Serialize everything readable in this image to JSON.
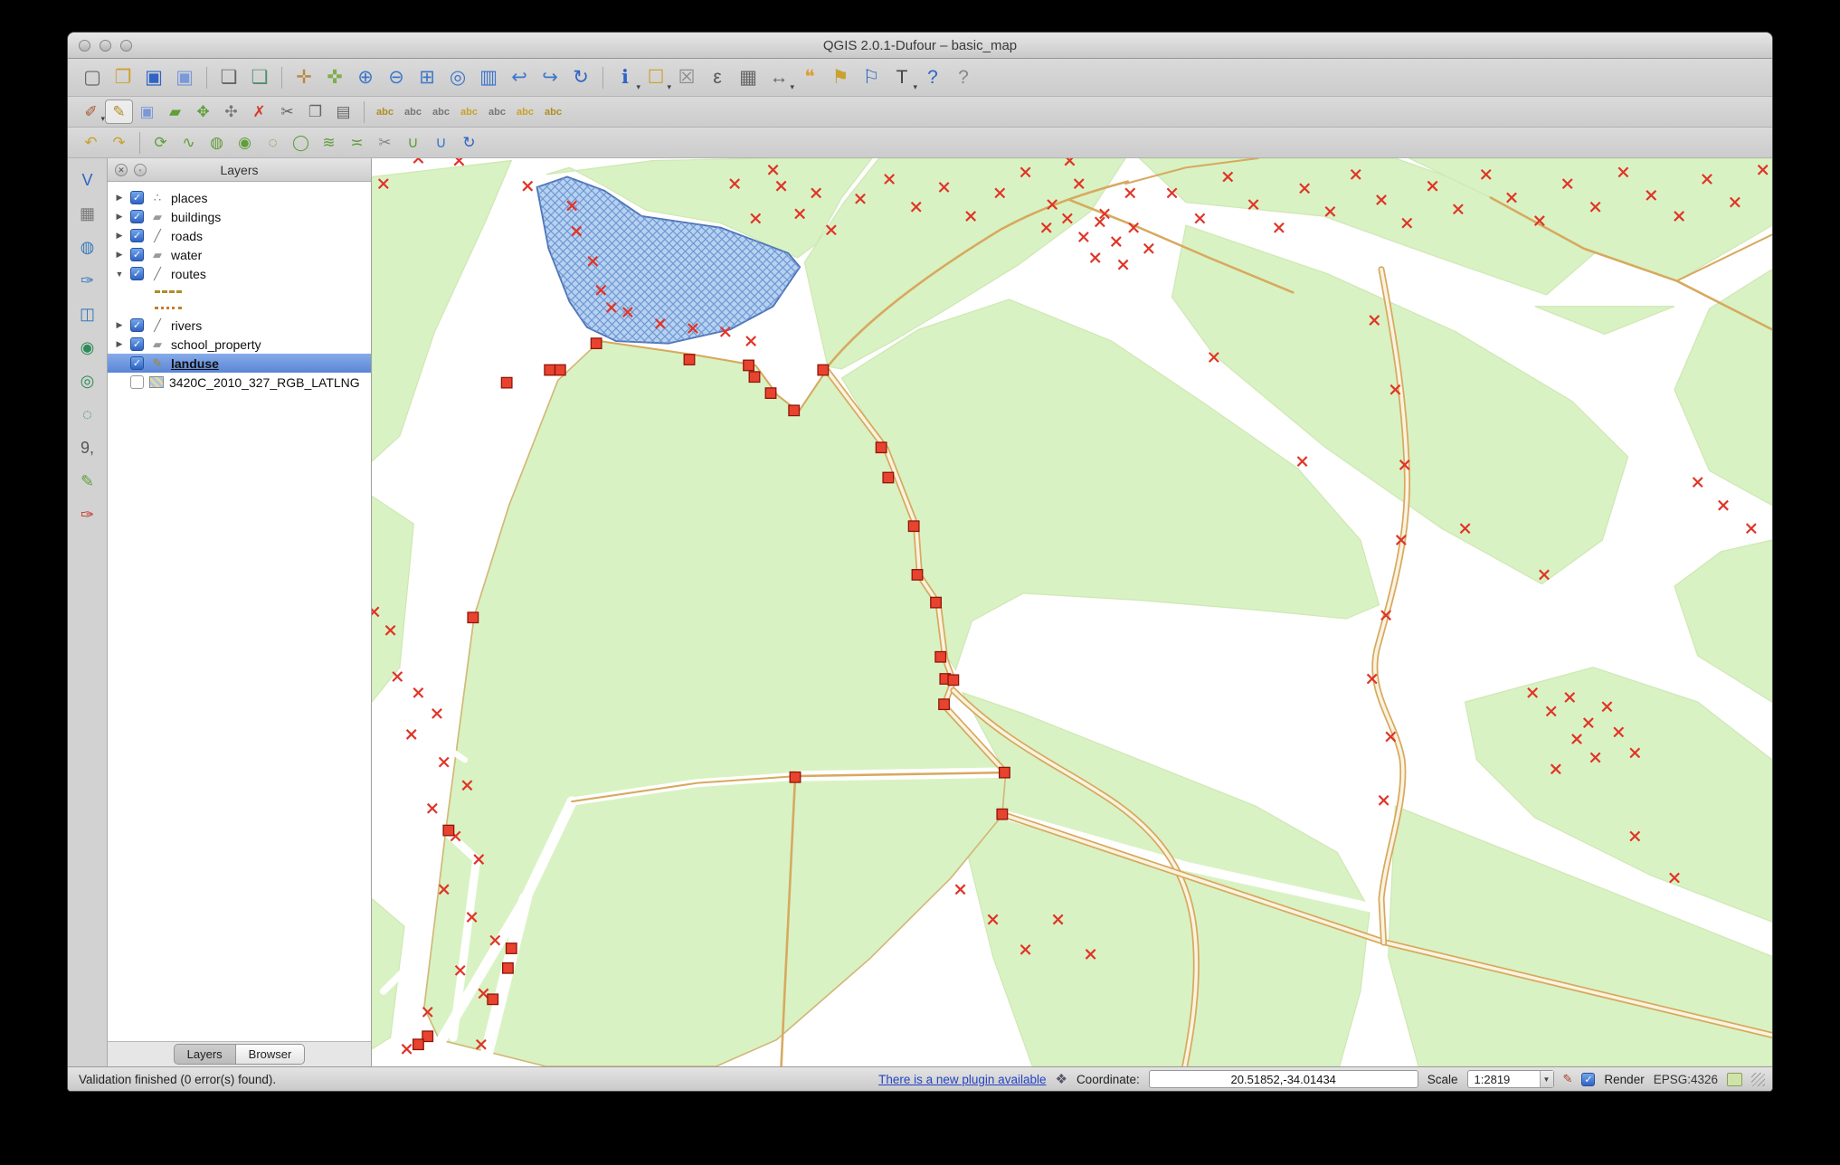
{
  "window": {
    "title": "QGIS 2.0.1-Dufour – basic_map"
  },
  "toolbars": {
    "row1": [
      {
        "name": "new-project",
        "glyph": "▢",
        "color": "#666"
      },
      {
        "name": "open-project",
        "glyph": "❐",
        "color": "#cfa02e"
      },
      {
        "name": "save-project",
        "glyph": "▣",
        "color": "#2f63c4"
      },
      {
        "name": "save-project-as",
        "glyph": "▣",
        "color": "#7b98d8"
      },
      {
        "sep": true
      },
      {
        "name": "new-print-composer",
        "glyph": "❏",
        "color": "#666"
      },
      {
        "name": "composer-manager",
        "glyph": "❏",
        "color": "#4f8f6f"
      },
      {
        "sep": true
      },
      {
        "name": "pan-map",
        "glyph": "✛",
        "color": "#b98a3f"
      },
      {
        "name": "pan-to-selection",
        "glyph": "✜",
        "color": "#7fae4f"
      },
      {
        "name": "zoom-in",
        "glyph": "⊕",
        "color": "#3e77c9"
      },
      {
        "name": "zoom-out",
        "glyph": "⊖",
        "color": "#3e77c9"
      },
      {
        "name": "zoom-full",
        "glyph": "⊞",
        "color": "#3e77c9"
      },
      {
        "name": "zoom-to-selection",
        "glyph": "◎",
        "color": "#3e77c9"
      },
      {
        "name": "zoom-to-layer",
        "glyph": "▥",
        "color": "#3e77c9"
      },
      {
        "name": "zoom-last",
        "glyph": "↩",
        "color": "#3e77c9"
      },
      {
        "name": "zoom-next",
        "glyph": "↪",
        "color": "#3e77c9"
      },
      {
        "name": "refresh-map",
        "glyph": "↻",
        "color": "#2f63c4"
      },
      {
        "sep": true
      },
      {
        "name": "identify-features",
        "glyph": "ℹ",
        "color": "#2f63c4",
        "dd": true
      },
      {
        "name": "select-features",
        "glyph": "☐",
        "color": "#caa12c",
        "dd": true
      },
      {
        "name": "deselect-features",
        "glyph": "☒",
        "color": "#8a8a8a"
      },
      {
        "name": "field-calculator",
        "glyph": "ε",
        "color": "#555"
      },
      {
        "name": "attribute-table",
        "glyph": "▦",
        "color": "#666"
      },
      {
        "name": "measure",
        "glyph": "↔",
        "color": "#666",
        "dd": true
      },
      {
        "name": "map-tips",
        "glyph": "❝",
        "color": "#dd9c2e"
      },
      {
        "name": "new-bookmark",
        "glyph": "⚑",
        "color": "#caa12c"
      },
      {
        "name": "show-bookmarks",
        "glyph": "⚐",
        "color": "#2f63c4"
      },
      {
        "name": "text-annotation",
        "glyph": "T",
        "color": "#444",
        "dd": true
      },
      {
        "name": "help-contents",
        "glyph": "?",
        "color": "#2f63c4"
      },
      {
        "name": "whats-this",
        "glyph": "?",
        "color": "#888"
      }
    ],
    "row2": [
      {
        "name": "current-edits",
        "glyph": "✐",
        "color": "#a5572c",
        "dd": true
      },
      {
        "name": "toggle-editing",
        "glyph": "✎",
        "color": "#b08c28",
        "pressed": true
      },
      {
        "name": "save-layer-edits",
        "glyph": "▣",
        "color": "#7b98d8"
      },
      {
        "name": "add-feature",
        "glyph": "▰",
        "color": "#5f9e3a"
      },
      {
        "name": "move-feature",
        "glyph": "✥",
        "color": "#5f9e3a"
      },
      {
        "name": "node-tool",
        "glyph": "✣",
        "color": "#777"
      },
      {
        "name": "delete-selected",
        "glyph": "✗",
        "color": "#d23b2e"
      },
      {
        "name": "cut-features",
        "glyph": "✂",
        "color": "#666"
      },
      {
        "name": "copy-features",
        "glyph": "❐",
        "color": "#666"
      },
      {
        "name": "paste-features",
        "glyph": "▤",
        "color": "#666"
      },
      {
        "sep": true
      },
      {
        "name": "layer-labeling-options",
        "glyph": "abc",
        "color": "#b08c28"
      },
      {
        "name": "move-label",
        "glyph": "abc",
        "color": "#777"
      },
      {
        "name": "rotate-label",
        "glyph": "abc",
        "color": "#777"
      },
      {
        "name": "pin-unpin-labels",
        "glyph": "abc",
        "color": "#caa12c"
      },
      {
        "name": "show-hide-labels",
        "glyph": "abc",
        "color": "#777"
      },
      {
        "name": "highlight-pinned-labels",
        "glyph": "abc",
        "color": "#caa12c"
      },
      {
        "name": "change-label-properties",
        "glyph": "abc",
        "color": "#b08c28"
      }
    ],
    "row3": [
      {
        "name": "undo",
        "glyph": "↶",
        "color": "#caa12c"
      },
      {
        "name": "redo",
        "glyph": "↷",
        "color": "#caa12c"
      },
      {
        "sep": true
      },
      {
        "name": "rotate-feature",
        "glyph": "⟳",
        "color": "#5f9e3a"
      },
      {
        "name": "simplify-feature",
        "glyph": "∿",
        "color": "#5f9e3a"
      },
      {
        "name": "add-ring",
        "glyph": "◍",
        "color": "#5f9e3a"
      },
      {
        "name": "add-part",
        "glyph": "◉",
        "color": "#5f9e3a"
      },
      {
        "name": "delete-ring",
        "glyph": "◌",
        "color": "#5f9e3a"
      },
      {
        "name": "delete-part",
        "glyph": "◯",
        "color": "#5f9e3a"
      },
      {
        "name": "reshape-features",
        "glyph": "≋",
        "color": "#5f9e3a"
      },
      {
        "name": "offset-curve",
        "glyph": "≍",
        "color": "#5f9e3a"
      },
      {
        "name": "split-features",
        "glyph": "✂",
        "color": "#888"
      },
      {
        "name": "merge-features",
        "glyph": "∪",
        "color": "#5f9e3a"
      },
      {
        "name": "merge-attributes",
        "glyph": "∪",
        "color": "#3e77c9"
      },
      {
        "name": "rotate-point-symbols",
        "glyph": "↻",
        "color": "#2f63c4"
      }
    ],
    "left": [
      {
        "name": "add-vector-layer",
        "glyph": "V",
        "color": "#2f63c4"
      },
      {
        "name": "add-raster-layer",
        "glyph": "▦",
        "color": "#777"
      },
      {
        "name": "add-postgis-layer",
        "glyph": "◍",
        "color": "#3a7abd"
      },
      {
        "name": "add-spatialite-layer",
        "glyph": "✑",
        "color": "#3a7abd"
      },
      {
        "name": "add-mssql-layer",
        "glyph": "◫",
        "color": "#3a7abd"
      },
      {
        "name": "add-wms-layer",
        "glyph": "◉",
        "color": "#2e8b57"
      },
      {
        "name": "add-wcs-layer",
        "glyph": "◎",
        "color": "#2e8b57"
      },
      {
        "name": "add-wfs-layer",
        "glyph": "◌",
        "color": "#2e8b57"
      },
      {
        "name": "add-delimited-text-layer",
        "glyph": "9,",
        "color": "#555"
      },
      {
        "name": "new-shapefile-layer",
        "glyph": "✎",
        "color": "#5f9e3a"
      },
      {
        "name": "new-spatialite-layer",
        "glyph": "✑",
        "color": "#c23b2e"
      }
    ]
  },
  "layers_panel": {
    "title": "Layers",
    "items": [
      {
        "label": "places",
        "checked": true,
        "icon": "point",
        "state": "collapsed"
      },
      {
        "label": "buildings",
        "checked": true,
        "icon": "polygon",
        "state": "collapsed"
      },
      {
        "label": "roads",
        "checked": true,
        "icon": "line",
        "state": "collapsed"
      },
      {
        "label": "water",
        "checked": true,
        "icon": "polygon",
        "state": "collapsed"
      },
      {
        "label": "routes",
        "checked": true,
        "icon": "line",
        "state": "expanded",
        "children": [
          {
            "swatch": "dash-long"
          },
          {
            "swatch": "dash-dot"
          }
        ]
      },
      {
        "label": "rivers",
        "checked": true,
        "icon": "line",
        "state": "collapsed"
      },
      {
        "label": "school_property",
        "checked": true,
        "icon": "polygon",
        "state": "collapsed"
      },
      {
        "label": "landuse",
        "checked": true,
        "icon": "editing",
        "state": "none",
        "selected": true,
        "editing": true
      },
      {
        "label": "3420C_2010_327_RGB_LATLNG",
        "checked": false,
        "icon": "raster",
        "state": "none"
      }
    ],
    "tabs": [
      {
        "label": "Layers",
        "active": true
      },
      {
        "label": "Browser",
        "active": false
      }
    ]
  },
  "status_bar": {
    "message": "Validation finished (0 error(s) found).",
    "plugin_link": "There is a new plugin available",
    "coordinate_label": "Coordinate:",
    "coordinate_value": "20.51852,-34.01434",
    "scale_label": "Scale",
    "scale_value": "1:2819",
    "render_label": "Render",
    "render_checked": true,
    "crs": "EPSG:4326"
  },
  "map": {
    "colors": {
      "landuse_fill": "#d9f2c3",
      "water_fill": "#b7d2f1",
      "water_border": "#4d74b8",
      "road": "#d7a95f",
      "vertex_marker": "#e03427",
      "selected_vertex": "#e8432f",
      "selection_highlight": "#5b86d6"
    }
  }
}
